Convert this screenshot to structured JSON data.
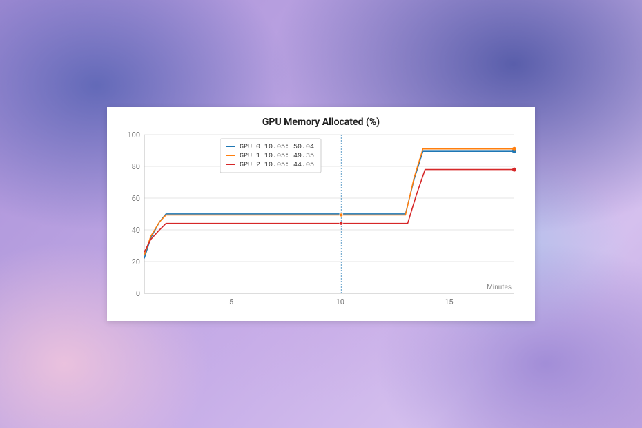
{
  "chart_data": {
    "type": "line",
    "title": "GPU Memory Allocated (%)",
    "xlabel": "Minutes",
    "ylabel": "",
    "x_ticks": [
      5,
      10,
      15
    ],
    "y_ticks": [
      0,
      20,
      40,
      60,
      80,
      100
    ],
    "xlim": [
      1,
      18
    ],
    "ylim": [
      0,
      100
    ],
    "cursor_x": 10.05,
    "series": [
      {
        "name": "GPU 0",
        "color": "#1f77b4",
        "cursor_value": 50.04,
        "x": [
          1.0,
          1.3,
          1.7,
          2.0,
          13.0,
          13.4,
          13.8,
          18.0
        ],
        "y": [
          22.0,
          35.0,
          45.0,
          50.04,
          50.04,
          72.0,
          89.5,
          89.5
        ]
      },
      {
        "name": "GPU 1",
        "color": "#ff7f0e",
        "cursor_value": 49.35,
        "x": [
          1.0,
          1.3,
          1.7,
          2.0,
          13.0,
          13.4,
          13.8,
          18.0
        ],
        "y": [
          24.0,
          36.0,
          45.0,
          49.35,
          49.35,
          73.0,
          91.0,
          91.0
        ]
      },
      {
        "name": "GPU 2",
        "color": "#d62728",
        "cursor_value": 44.05,
        "x": [
          1.0,
          1.3,
          1.7,
          2.0,
          13.1,
          13.5,
          13.9,
          18.0
        ],
        "y": [
          26.0,
          34.0,
          40.0,
          44.05,
          44.05,
          62.0,
          78.0,
          78.0
        ]
      }
    ],
    "legend_entries": [
      "GPU 0 10.05: 50.04",
      "GPU 1 10.05: 49.35",
      "GPU 2 10.05: 44.05"
    ]
  }
}
